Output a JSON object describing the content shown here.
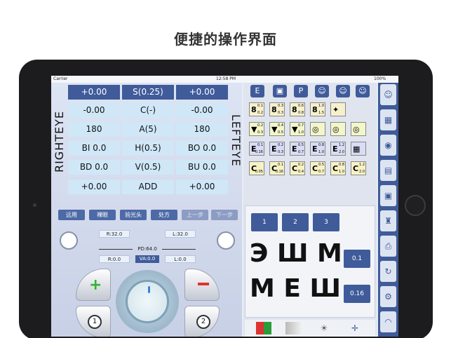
{
  "caption": "便捷的操作界面",
  "status_bar": {
    "carrier": "Carrier",
    "time": "12:58 PM",
    "battery": "100%"
  },
  "eye_labels": {
    "right": "RIGHTEYE",
    "left": "LEFTEYE"
  },
  "grid": {
    "header": [
      "+0.00",
      "S(0.25)",
      "+0.00"
    ],
    "rows": [
      [
        "-0.00",
        "C(-)",
        "-0.00"
      ],
      [
        "180",
        "A(5)",
        "180"
      ],
      [
        "BI 0.0",
        "H(0.5)",
        "BO 0.0"
      ],
      [
        "BD 0.0",
        "V(0.5)",
        "BU 0.0"
      ],
      [
        "+0.00",
        "ADD",
        "+0.00"
      ]
    ]
  },
  "function_buttons": [
    "远用",
    "裸眼",
    "验光头",
    "处方",
    "上一步",
    "下一步"
  ],
  "pd": {
    "r": "R:32.0",
    "l": "L:32.0",
    "pd": "PD:64.0",
    "r0": "R:0.0",
    "va": "VA:0.0",
    "l0": "L:0.0"
  },
  "step_labels": {
    "one": "1",
    "two": "2"
  },
  "optotypes": {
    "header_icons": [
      "E",
      "▣",
      "P",
      "👤",
      "👤",
      "👤"
    ],
    "rows": [
      [
        {
          "glyph": "8",
          "a": "0.1",
          "b": "0.2"
        },
        {
          "glyph": "8",
          "a": "0.3",
          "b": "0.3"
        },
        {
          "glyph": "8",
          "a": "0.6",
          "b": "0.8"
        },
        {
          "glyph": "8",
          "a": "1.0",
          "b": "1.5"
        },
        {
          "glyph": "✦",
          "a": "",
          "b": ""
        }
      ],
      [
        {
          "glyph": "▼",
          "a": "0.2",
          "b": "0.3"
        },
        {
          "glyph": "▼",
          "a": "0.4",
          "b": "0.5"
        },
        {
          "glyph": "▼",
          "a": "0.7",
          "b": "1.0"
        },
        {
          "glyph": "◎",
          "a": "",
          "b": ""
        },
        {
          "glyph": "◎",
          "a": "",
          "b": ""
        },
        {
          "glyph": "◎",
          "a": "",
          "b": ""
        }
      ],
      [
        {
          "glyph": "E",
          "a": "0.1",
          "b": "0.16"
        },
        {
          "glyph": "E",
          "a": "0.2",
          "b": "0.3"
        },
        {
          "glyph": "E",
          "a": "0.5",
          "b": "0.7"
        },
        {
          "glyph": "E",
          "a": "0.8",
          "b": "1.0"
        },
        {
          "glyph": "E",
          "a": "1.2",
          "b": "2.0"
        },
        {
          "glyph": "▦",
          "a": "",
          "b": ""
        }
      ],
      [
        {
          "glyph": "C",
          "a": "",
          "b": "0.05"
        },
        {
          "glyph": "C",
          "a": "0.1",
          "b": "0.16"
        },
        {
          "glyph": "C",
          "a": "0.2",
          "b": "0.4"
        },
        {
          "glyph": "C",
          "a": "0.5",
          "b": "0.7"
        },
        {
          "glyph": "C",
          "a": "0.8",
          "b": "1.0"
        },
        {
          "glyph": "C",
          "a": "1.2",
          "b": "2.0"
        }
      ]
    ]
  },
  "chart_panel": {
    "number_buttons": [
      "1",
      "2",
      "3"
    ],
    "row1": {
      "letters": "ЭШМ",
      "acuity": "0.1"
    },
    "row2": {
      "letters": "ММШ",
      "acuity": "0.16"
    }
  },
  "sidebar_icons": [
    "person-icon",
    "grid-icon",
    "phoropter-icon",
    "chart-icon",
    "projector-icon",
    "robot-icon",
    "printer-icon",
    "refresh-icon",
    "settings-icon",
    "wifi-icon"
  ]
}
